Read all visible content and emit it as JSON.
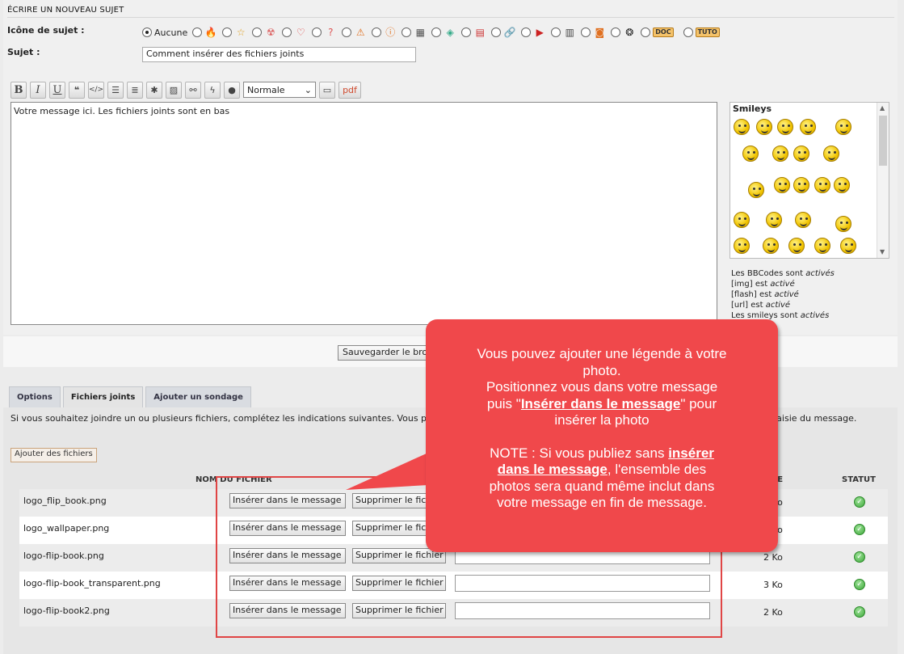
{
  "form": {
    "section_title": "Écrire un nouveau sujet",
    "topic_icon_label": "Icône de sujet :",
    "no_icon_label": "Aucune",
    "icon_tags": [
      "DOC",
      "TUTO"
    ],
    "subject_label": "Sujet :",
    "subject_value": "Comment insérer des fichiers joints"
  },
  "toolbar": {
    "bold": "B",
    "italic": "I",
    "underline": "U",
    "quote": "❝",
    "code": "</>",
    "font_size_value": "Normale",
    "pdf": "pdf"
  },
  "editor": {
    "text": "Votre message ici. Les fichiers joints sont en bas"
  },
  "smileys": {
    "title": "Smileys"
  },
  "bbcode": {
    "l1a": "Les BBCodes sont",
    "l1b": "activés",
    "l2a": "[img] est",
    "l2b": "activé",
    "l3a": "[flash] est",
    "l3b": "activé",
    "l4a": "[url] est",
    "l4b": "activé",
    "l5a": "Les smileys sont",
    "l5b": "activés"
  },
  "save_button": "Sauvegarder le brouillon",
  "tabs": [
    "Options",
    "Fichiers joints",
    "Ajouter un sondage"
  ],
  "attachments": {
    "intro": "Si vous souhaitez joindre un ou plusieurs fichiers, complétez les indications suivantes. Vous pouvez également glisser et déposer vos fichiers directement dans la zone de saisie du message.",
    "add_button": "Ajouter des fichiers",
    "col_filename": "NOM DU FICHIER",
    "col_size": "TAILLE",
    "col_status": "STATUT",
    "insert_label": "Insérer dans le message",
    "delete_label": "Supprimer le fichier",
    "files": [
      {
        "name": "logo_flip_book.png",
        "size": "2 Ko"
      },
      {
        "name": "logo_wallpaper.png",
        "size": "7 Ko"
      },
      {
        "name": "logo-flip-book.png",
        "size": "2 Ko"
      },
      {
        "name": "logo-flip-book_transparent.png",
        "size": "3 Ko"
      },
      {
        "name": "logo-flip-book2.png",
        "size": "2 Ko"
      }
    ]
  },
  "callout": {
    "line1": "Vous pouvez ajouter une légende à votre",
    "line2": "photo.",
    "line3": "Positionnez vous dans votre message",
    "line4a": "puis \"",
    "line4b": "Insérer dans le message",
    "line4c": "\" pour",
    "line5": "insérer la photo",
    "note_a": "NOTE : Si vous publiez sans",
    "note_b1": "insérer",
    "note_b2": "dans le message",
    "note_c": ", l'ensemble des",
    "note_d": "photos sera quand même inclut dans",
    "note_e": "votre message en fin de message."
  },
  "colors": {
    "callout": "#f0484b",
    "highlight": "#e04545",
    "ok": "#3ea83a"
  }
}
